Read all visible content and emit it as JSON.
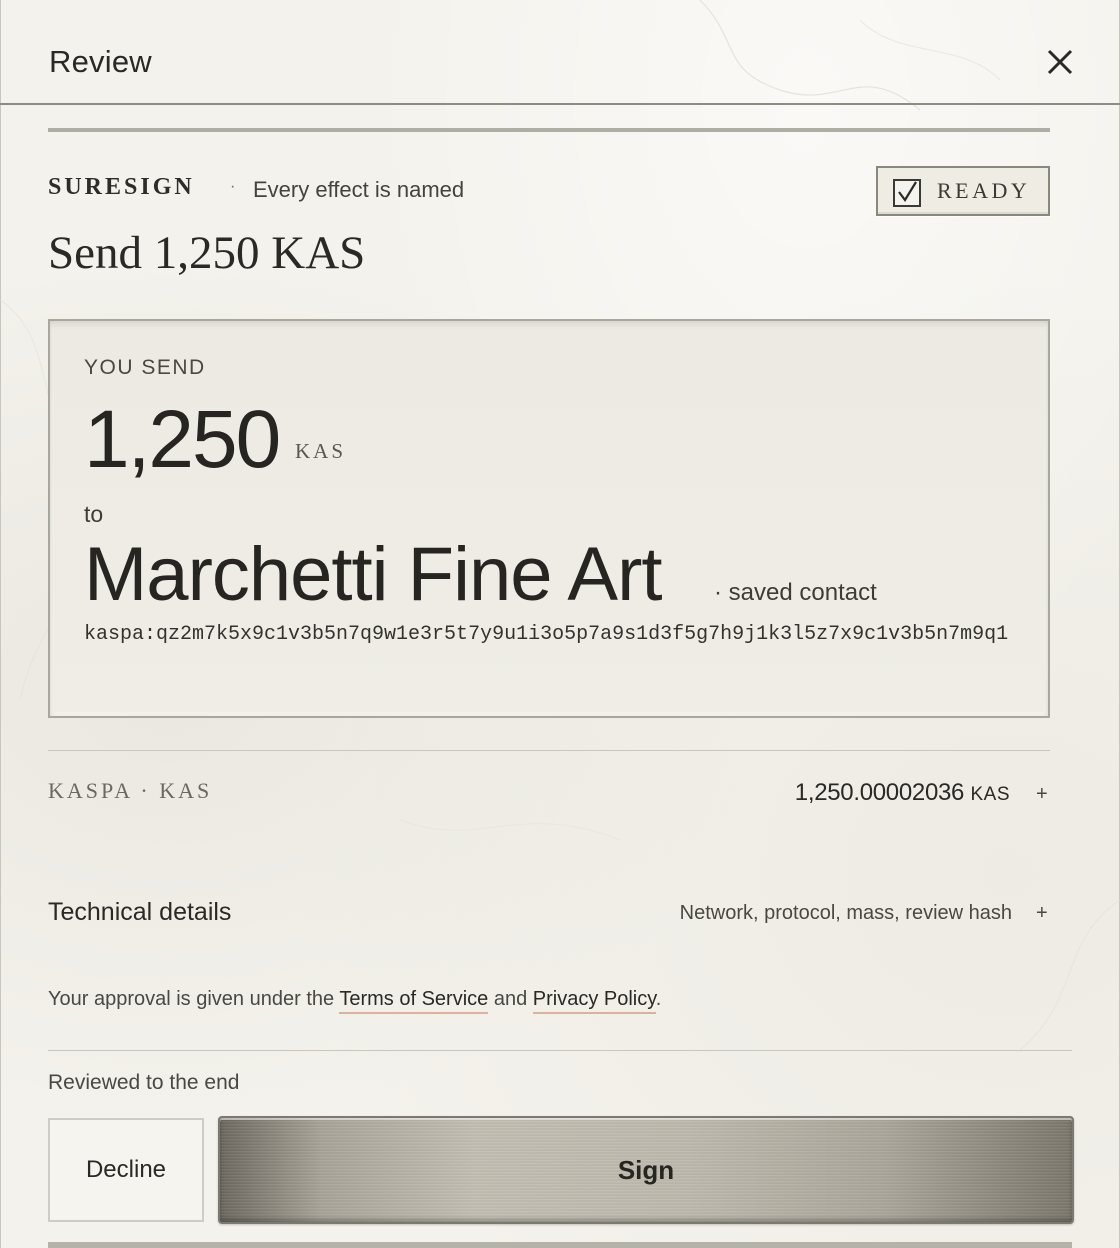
{
  "header": {
    "title": "Review",
    "close_icon": "close-icon"
  },
  "brand": {
    "name": "SURESIGN",
    "separator": "·",
    "tagline": "Every effect is named"
  },
  "status": {
    "label": "READY",
    "checked": true,
    "icon": "checkbox-checked-icon"
  },
  "headline": "Send 1,250 KAS",
  "transfer": {
    "section_label": "YOU SEND",
    "amount": "1,250",
    "unit": "KAS",
    "to_label": "to",
    "recipient": "Marchetti Fine Art",
    "recipient_note": "· saved contact",
    "address": "kaspa:qz2m7k5x9c1v3b5n7q9w1e3r5t7y9u1i3o5p7a9s1d3f5g7h9j1k3l5z7x9c1v3b5n7m9q1"
  },
  "asset_row": {
    "label": "KASPA · KAS",
    "amount": "1,250.00002036",
    "unit": "KAS",
    "expand": "+"
  },
  "technical": {
    "title": "Technical details",
    "description": "Network, protocol, mass, review hash",
    "expand": "+"
  },
  "legal": {
    "prefix": "Your approval is given under the ",
    "terms": "Terms of Service",
    "middle": " and ",
    "privacy": "Privacy Policy",
    "suffix": "."
  },
  "footer": {
    "reviewed": "Reviewed to the end",
    "decline": "Decline",
    "sign": "Sign"
  },
  "colors": {
    "background": "#f4f2ec",
    "text": "#2a2925",
    "link_underline": "#d9b3a0",
    "sign_button": "#b5b0a4"
  }
}
